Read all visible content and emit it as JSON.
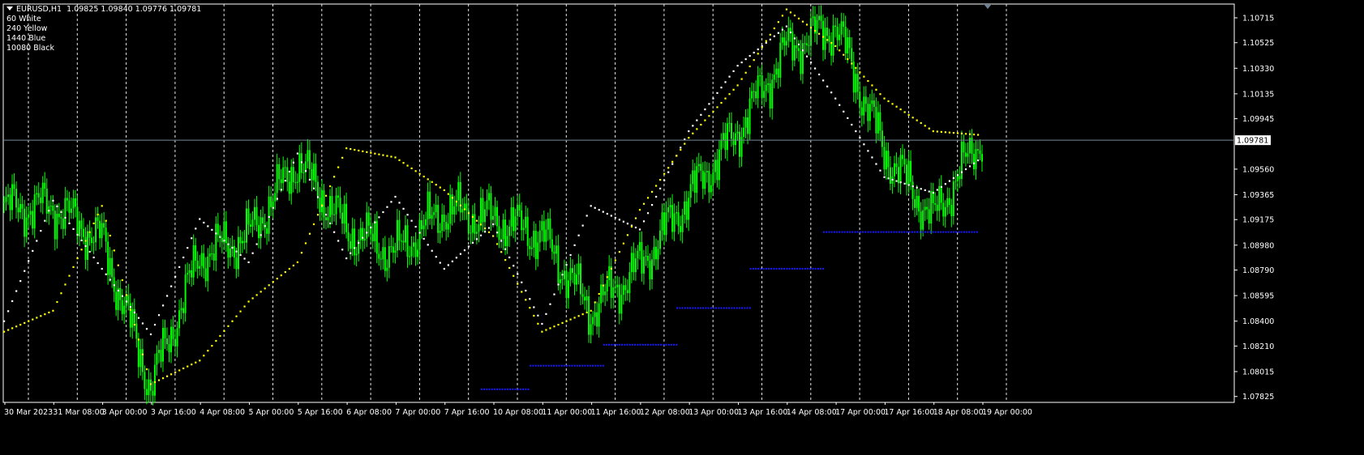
{
  "window": {
    "symbol": "EURUSD,H1",
    "ohlc": "1.09825 1.09840 1.09776 1.09781"
  },
  "legend_items": [
    "60 White",
    "240 Yellow",
    "1440 Blue",
    "10080 Black"
  ],
  "current_price_label": "1.09781",
  "colors": {
    "background": "#000000",
    "candles": "#00ff00",
    "grid": "#ffffff",
    "axis_text": "#ffffff",
    "psar_60": "#ffffff",
    "psar_240": "#ffff00",
    "psar_1440": "#1a1aff",
    "price_line": "#778899"
  },
  "chart_data": {
    "type": "line",
    "y_ticks": [
      "1.10715",
      "1.10525",
      "1.10330",
      "1.10135",
      "1.09945",
      "1.09560",
      "1.09365",
      "1.09175",
      "1.08980",
      "1.08790",
      "1.08595",
      "1.08400",
      "1.08210",
      "1.08015",
      "1.07825"
    ],
    "x_ticks": [
      "30 Mar 2023",
      "31 Mar 08:00",
      "3 Apr 00:00",
      "3 Apr 16:00",
      "4 Apr 08:00",
      "5 Apr 00:00",
      "5 Apr 16:00",
      "6 Apr 08:00",
      "7 Apr 00:00",
      "7 Apr 16:00",
      "10 Apr 08:00",
      "11 Apr 00:00",
      "11 Apr 16:00",
      "12 Apr 08:00",
      "13 Apr 00:00",
      "13 Apr 16:00",
      "14 Apr 08:00",
      "17 Apr 00:00",
      "17 Apr 16:00",
      "18 Apr 08:00",
      "19 Apr 00:00"
    ],
    "ylim": [
      1.0778,
      1.1082
    ],
    "grid": true,
    "last_price": 1.09781,
    "series": [
      {
        "name": "EURUSD,H1",
        "kind": "price",
        "x": [
          0,
          1,
          2,
          3,
          4,
          5,
          6,
          7,
          8,
          9,
          10,
          11,
          12,
          13,
          14,
          15,
          16,
          17,
          18,
          19,
          20
        ],
        "values": [
          1.0926,
          1.0928,
          1.0902,
          1.079,
          1.089,
          1.0905,
          1.0962,
          1.091,
          1.0892,
          1.0925,
          1.0918,
          1.0905,
          1.0848,
          1.0882,
          1.0935,
          1.0985,
          1.1048,
          1.1066,
          1.097,
          1.0918,
          1.0982
        ]
      },
      {
        "name": "60 White",
        "kind": "psar",
        "x": [
          0,
          1,
          2,
          3,
          4,
          5,
          6,
          7,
          8,
          9,
          10,
          11,
          12,
          13,
          14,
          15,
          16,
          17,
          18,
          19,
          20
        ],
        "values": [
          1.084,
          1.0932,
          1.088,
          1.083,
          1.0918,
          1.0885,
          1.0968,
          1.0888,
          1.0935,
          1.088,
          1.0914,
          1.0838,
          1.0928,
          1.091,
          1.0985,
          1.1035,
          1.1065,
          1.101,
          1.095,
          1.0938,
          1.0965
        ]
      },
      {
        "name": "240 Yellow",
        "kind": "psar",
        "x": [
          0,
          1,
          2,
          3,
          4,
          5,
          6,
          7,
          8,
          9,
          10,
          11,
          12,
          13,
          14,
          15,
          16,
          17,
          18,
          19,
          20
        ],
        "values": [
          1.0832,
          1.0848,
          1.0928,
          1.0792,
          1.081,
          1.0855,
          1.0885,
          1.0972,
          1.0965,
          1.094,
          1.0905,
          1.0832,
          1.0848,
          1.0925,
          1.098,
          1.102,
          1.1078,
          1.105,
          1.101,
          1.0985,
          1.0982
        ]
      },
      {
        "name": "1440 Blue",
        "kind": "psar",
        "x": [
          9.75,
          10.75,
          10.75,
          12.25,
          12.25,
          13.75,
          13.75,
          15.25,
          15.25,
          16.75,
          16.75,
          19.9
        ],
        "values": [
          1.0788,
          1.0788,
          1.0806,
          1.0806,
          1.0822,
          1.0822,
          1.085,
          1.085,
          1.088,
          1.088,
          1.0908,
          1.0908
        ],
        "segments": [
          [
            0,
            1
          ],
          [
            2,
            3
          ],
          [
            4,
            5
          ],
          [
            6,
            7
          ],
          [
            8,
            9
          ],
          [
            10,
            11
          ]
        ]
      }
    ]
  }
}
